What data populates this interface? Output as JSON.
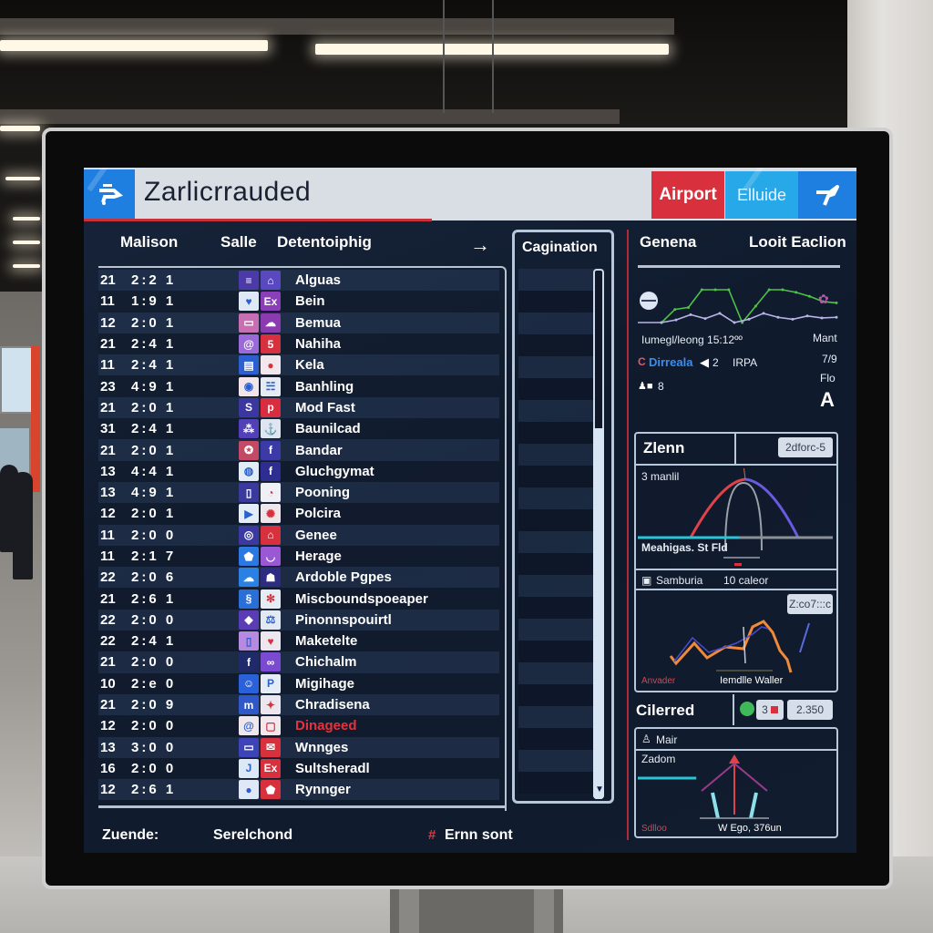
{
  "header": {
    "title": "Zarlicrrauded",
    "logo_icon": "train-icon",
    "airport_label": "Airport",
    "elude_label": "Elluide",
    "plane_icon": "plane-icon",
    "colors": {
      "brand_blue": "#1e7fe0",
      "airport_red": "#d9303d",
      "elude_cyan": "#27a8e8"
    }
  },
  "columns": {
    "gate": "Malison",
    "time": "Salle",
    "destination": "Detentoiphig",
    "arrow_icon": "arrow-right-icon",
    "pagination": "Cagination",
    "right_1": "Genena",
    "right_2": "Looit Eaclion"
  },
  "flights": [
    {
      "gate": "21",
      "time": "2:2 1",
      "icons": [
        "menu-circle-icon",
        "lock-icon"
      ],
      "icon_colors": [
        "#4b3aa8",
        "#5a48c0"
      ],
      "name": "Alguas",
      "alert": false
    },
    {
      "gate": "11",
      "time": "1:9 1",
      "icons": [
        "heart-icon",
        "text-icon"
      ],
      "icon_colors": [
        "#dfe9f5",
        "#8a3fb8"
      ],
      "name": "Bein",
      "alert": false
    },
    {
      "gate": "12",
      "time": "2:0 1",
      "icons": [
        "chat-icon",
        "cloud-icon"
      ],
      "icon_colors": [
        "#c86fb2",
        "#8c3ab0"
      ],
      "name": "Bemua",
      "alert": false
    },
    {
      "gate": "21",
      "time": "2:4 1",
      "icons": [
        "swirl-icon",
        "html-icon"
      ],
      "icon_colors": [
        "#9a6ad8",
        "#d7303e"
      ],
      "name": "Nahiha",
      "alert": false
    },
    {
      "gate": "11",
      "time": "2:4 1",
      "icons": [
        "message-icon",
        "pin-icon"
      ],
      "icon_colors": [
        "#2d5fd0",
        "#f1e7ec"
      ],
      "name": "Kela",
      "alert": false
    },
    {
      "gate": "23",
      "time": "4:9 1",
      "icons": [
        "record-icon",
        "doodle-icon"
      ],
      "icon_colors": [
        "#f1e5ea",
        "#e4ebf3"
      ],
      "name": "Banhling",
      "alert": false
    },
    {
      "gate": "21",
      "time": "2:0 1",
      "icons": [
        "s-logo-icon",
        "pinterest-icon"
      ],
      "icon_colors": [
        "#3b36a0",
        "#d92d3f"
      ],
      "name": "Mod Fast",
      "alert": false
    },
    {
      "gate": "31",
      "time": "2:4 1",
      "icons": [
        "pattern-icon",
        "anchor-icon"
      ],
      "icon_colors": [
        "#5140b8",
        "#dfe6f2"
      ],
      "name": "Baunilcad",
      "alert": false
    },
    {
      "gate": "21",
      "time": "2:0 1",
      "icons": [
        "badge-icon",
        "facebook-icon"
      ],
      "icon_colors": [
        "#c24a66",
        "#3b3aa6"
      ],
      "name": "Bandar",
      "alert": false
    },
    {
      "gate": "13",
      "time": "4:4 1",
      "icons": [
        "bubble-icon",
        "facebook-icon"
      ],
      "icon_colors": [
        "#e2ecf6",
        "#2e2e92"
      ],
      "name": "Gluchgymat",
      "alert": false
    },
    {
      "gate": "13",
      "time": "4:9 1",
      "icons": [
        "tablet-icon",
        "pacman-icon"
      ],
      "icon_colors": [
        "#3a3a9c",
        "#eef0f5"
      ],
      "name": "Pooning",
      "alert": false
    },
    {
      "gate": "12",
      "time": "2:0 1",
      "icons": [
        "play-icon",
        "brain-icon"
      ],
      "icon_colors": [
        "#e4ecf6",
        "#efe6ea"
      ],
      "name": "Polcira",
      "alert": false
    },
    {
      "gate": "11",
      "time": "2:0 0",
      "icons": [
        "target-icon",
        "lock-icon"
      ],
      "icon_colors": [
        "#3c3aa0",
        "#d9303d"
      ],
      "name": "Genee",
      "alert": false
    },
    {
      "gate": "11",
      "time": "2:1 7",
      "icons": [
        "shield-icon",
        "mask-icon"
      ],
      "icon_colors": [
        "#2b78e0",
        "#9a58d4"
      ],
      "name": "Herage",
      "alert": false
    },
    {
      "gate": "22",
      "time": "2:0 6",
      "icons": [
        "cloud-icon",
        "robot-icon"
      ],
      "icon_colors": [
        "#2b80e4",
        "#2c2c80"
      ],
      "name": "Ardoble Pgpes",
      "alert": false
    },
    {
      "gate": "21",
      "time": "2:6 1",
      "icons": [
        "scribble-icon",
        "flower-icon"
      ],
      "icon_colors": [
        "#2a6fd8",
        "#e5ecf4"
      ],
      "name": "Miscboundspoeaper",
      "alert": false
    },
    {
      "gate": "22",
      "time": "2:0 0",
      "icons": [
        "diamond-icon",
        "scale-icon"
      ],
      "icon_colors": [
        "#5a3cb4",
        "#e2e9f2"
      ],
      "name": "Pinonnspouirtl",
      "alert": false
    },
    {
      "gate": "22",
      "time": "2:4 1",
      "icons": [
        "phone-icon",
        "heart-icon"
      ],
      "icon_colors": [
        "#b68ae0",
        "#ece6ee"
      ],
      "name": "Maketelte",
      "alert": false
    },
    {
      "gate": "21",
      "time": "2:0 0",
      "icons": [
        "facebook-icon",
        "link-icon"
      ],
      "icon_colors": [
        "#1f2a6a",
        "#7a4ad0"
      ],
      "name": "Chichalm",
      "alert": false
    },
    {
      "gate": "10",
      "time": "2:e 0",
      "icons": [
        "smile-icon",
        "paypal-icon"
      ],
      "icon_colors": [
        "#2a60d8",
        "#e4ecf6"
      ],
      "name": "Migihage",
      "alert": false
    },
    {
      "gate": "21",
      "time": "2:0 9",
      "icons": [
        "m-logo-icon",
        "puzzle-icon"
      ],
      "icon_colors": [
        "#2f58c8",
        "#ece6ee"
      ],
      "name": "Chradisena",
      "alert": false
    },
    {
      "gate": "12",
      "time": "2:0 0",
      "icons": [
        "swirl-icon",
        "note-icon"
      ],
      "icon_colors": [
        "#eee7ee",
        "#f1e7ec"
      ],
      "name": "Dinageed",
      "alert": true
    },
    {
      "gate": "13",
      "time": "3:0 0",
      "icons": [
        "chat-icon",
        "sticker-icon"
      ],
      "icon_colors": [
        "#3c44b8",
        "#d9303d"
      ],
      "name": "Wnnges",
      "alert": false
    },
    {
      "gate": "16",
      "time": "2:0 0",
      "icons": [
        "hook-icon",
        "text-icon"
      ],
      "icon_colors": [
        "#dde8f6",
        "#d9303d"
      ],
      "name": "Sultsheradl",
      "alert": false
    },
    {
      "gate": "12",
      "time": "2:6 1",
      "icons": [
        "drop-icon",
        "shield-icon"
      ],
      "icon_colors": [
        "#dfe8f6",
        "#d9303d"
      ],
      "name": "Rynnger",
      "alert": false
    }
  ],
  "pagination": {
    "title": "Cagination",
    "rows": 24,
    "scroll_position_fraction": 0.3,
    "scroll_thumb_fraction": 0.7,
    "scroll_down_icon": "triangle-down-icon"
  },
  "right_panel": {
    "top_chart": {
      "left_icon": "pill-icon",
      "right_icon": "butterfly-icon",
      "series": [
        {
          "name": "green",
          "color": "#4fc24a",
          "values": [
            0,
            2,
            2.3,
            5,
            5,
            5,
            0,
            2.5,
            5,
            5,
            4.6,
            4,
            3.2,
            3
          ]
        },
        {
          "name": "lavender",
          "color": "#b9b4e8",
          "values": [
            0,
            0.4,
            1.2,
            0.6,
            1.4,
            0,
            0.5,
            1.4,
            0.8,
            0.5,
            1.0,
            0.7,
            0.8
          ]
        }
      ],
      "caption": "Iumegl/leong 15:12ºº",
      "side_1": "Mant",
      "side_2": "7/9",
      "side_3": "Flo",
      "side_4": "A",
      "link_label": "Dirreala",
      "link_icon": "swirl-icon",
      "nav_prev_icon": "triangle-left-icon",
      "nav_value": "2",
      "nav_code": "IRPA",
      "status_icons": "person-bag-icon",
      "status_value": "8"
    },
    "zoom_card": {
      "title": "Zlenn",
      "badge": "2dforc-5",
      "label_top": "3 manlil",
      "label_bottom": "Meahigas. St Fld",
      "curves": [
        {
          "name": "red",
          "color": "#e0424a"
        },
        {
          "name": "blue",
          "color": "#6a5ae0"
        },
        {
          "name": "gray",
          "color": "#9aa0a8"
        }
      ],
      "progress_fraction": 0.52,
      "progress_color": "#2bc4d6"
    },
    "samburia_card": {
      "label": "Samburia",
      "count": "10 caleor",
      "badge": "Z:co7:::c",
      "footer_left": "Anvader",
      "footer_center": "Iemdlle Waller",
      "series": [
        {
          "name": "orange",
          "color": "#f08a3a"
        },
        {
          "name": "navy",
          "color": "#4a4ad0"
        }
      ]
    },
    "cilerred": {
      "title": "Cilerred",
      "icon": "frog-icon",
      "value_1": "3",
      "value_2": "2.350"
    },
    "mair_card": {
      "title": "Mair",
      "title_icon": "person-icon",
      "label": "Zadom",
      "footer_left": "Sdlloo",
      "footer_right": "W Ego, 376un",
      "progress_fraction": 0.3
    }
  },
  "footer": {
    "label_1": "Zuende:",
    "label_2": "Serelchond",
    "alert_icon": "hash-icon",
    "label_3": "Ernn sont"
  }
}
